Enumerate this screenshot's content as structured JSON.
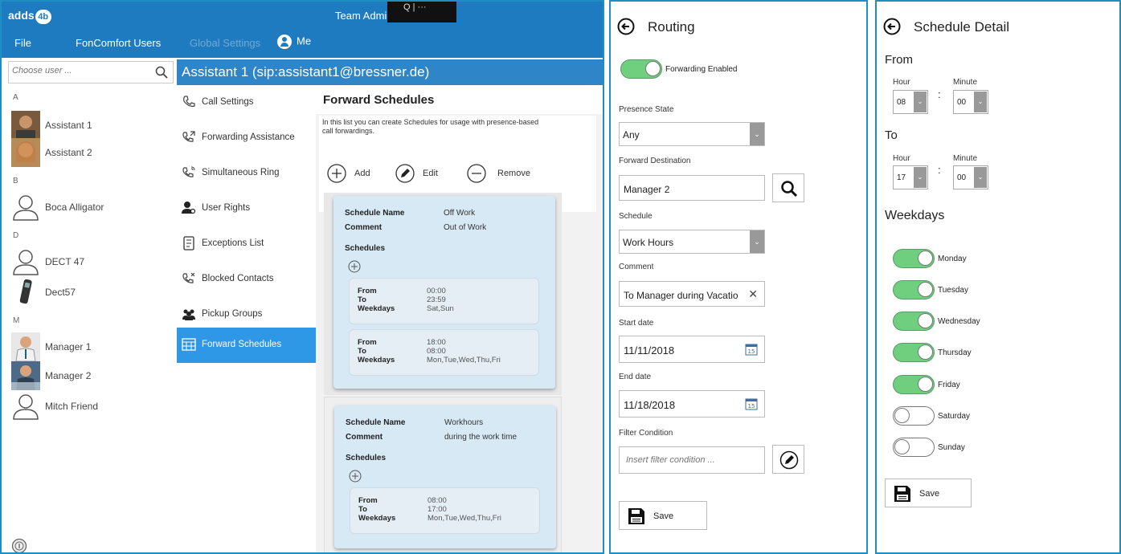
{
  "app": {
    "logo_text": "adds",
    "logo_badge": "4b",
    "title": "Team Admin Dashboard",
    "overlay_text": "Q | ···"
  },
  "menu": {
    "file": "File",
    "foncomfort_users": "FonComfort Users",
    "global_settings": "Global Settings",
    "me": "Me"
  },
  "user_search": {
    "placeholder": "Choose user ..."
  },
  "user_groups": [
    {
      "letter": "A",
      "users": [
        "Assistant 1",
        "Assistant 2"
      ]
    },
    {
      "letter": "B",
      "users": [
        "Boca Alligator"
      ]
    },
    {
      "letter": "D",
      "users": [
        "DECT 47",
        "Dect57"
      ]
    },
    {
      "letter": "M",
      "users": [
        "Manager 1",
        "Manager 2",
        "Mitch Friend"
      ]
    }
  ],
  "group_letters": {
    "a": "A",
    "b": "B",
    "d": "D",
    "m": "M"
  },
  "users": {
    "assistant1": "Assistant 1",
    "assistant2": "Assistant 2",
    "boca": "Boca Alligator",
    "dect47": "DECT 47",
    "dect57": "Dect57",
    "manager1": "Manager 1",
    "manager2": "Manager 2",
    "mitch": "Mitch Friend"
  },
  "detail_header": "Assistant 1 (sip:assistant1@bressner.de)",
  "nav": {
    "call_settings": "Call Settings",
    "forwarding_assistance": "Forwarding Assistance",
    "simultaneous_ring": "Simultaneous Ring",
    "user_rights": "User Rights",
    "exceptions_list": "Exceptions List",
    "blocked_contacts": "Blocked Contacts",
    "pickup_groups": "Pickup Groups",
    "forward_schedules": "Forward Schedules",
    "active": "Forward Schedules"
  },
  "forward_schedules": {
    "title": "Forward Schedules",
    "description": "In this list you can create Schedules for usage with presence-based call forwardings.",
    "add": "Add",
    "edit": "Edit",
    "remove": "Remove",
    "labels": {
      "schedule_name": "Schedule Name",
      "comment": "Comment",
      "schedules": "Schedules",
      "from": "From",
      "to": "To",
      "weekdays": "Weekdays"
    },
    "cards": [
      {
        "name": "Off Work",
        "comment": "Out of Work",
        "schedules": [
          {
            "from": "00:00",
            "to": "23:59",
            "weekdays": "Sat,Sun"
          },
          {
            "from": "18:00",
            "to": "08:00",
            "weekdays": "Mon,Tue,Wed,Thu,Fri"
          }
        ]
      },
      {
        "name": "Workhours",
        "comment": "during the work time",
        "schedules": [
          {
            "from": "08:00",
            "to": "17:00",
            "weekdays": "Mon,Tue,Wed,Thu,Fri"
          }
        ]
      }
    ]
  },
  "routing": {
    "title": "Routing",
    "forwarding_enabled_label": "Forwarding Enabled",
    "forwarding_enabled": true,
    "presence_state_label": "Presence State",
    "presence_state_value": "Any",
    "forward_destination_label": "Forward Destination",
    "forward_destination_value": "Manager 2",
    "schedule_label": "Schedule",
    "schedule_value": "Work Hours",
    "comment_label": "Comment",
    "comment_value": "To Manager during Vacatio",
    "start_date_label": "Start date",
    "start_date_value": "11/11/2018",
    "end_date_label": "End date",
    "end_date_value": "11/18/2018",
    "calendar_day": "15",
    "filter_condition_label": "Filter Condition",
    "filter_condition_placeholder": "Insert filter condition ...",
    "save": "Save"
  },
  "schedule_detail": {
    "title": "Schedule Detail",
    "from_label": "From",
    "to_label": "To",
    "hour_label": "Hour",
    "minute_label": "Minute",
    "from_hour": "08",
    "from_minute": "00",
    "to_hour": "17",
    "to_minute": "00",
    "weekdays_label": "Weekdays",
    "days": {
      "monday": "Monday",
      "tuesday": "Tuesday",
      "wednesday": "Wednesday",
      "thursday": "Thursday",
      "friday": "Friday",
      "saturday": "Saturday",
      "sunday": "Sunday"
    },
    "days_enabled": [
      true,
      true,
      true,
      true,
      true,
      false,
      false
    ],
    "save": "Save"
  },
  "colors": {
    "titlebar": "#1f7bbf",
    "header": "#2e86c8",
    "nav_active": "#2e97e6",
    "toggle_on": "#6fcf7f",
    "panel_border": "#1e8fc4",
    "card": "#d8e9f6"
  }
}
